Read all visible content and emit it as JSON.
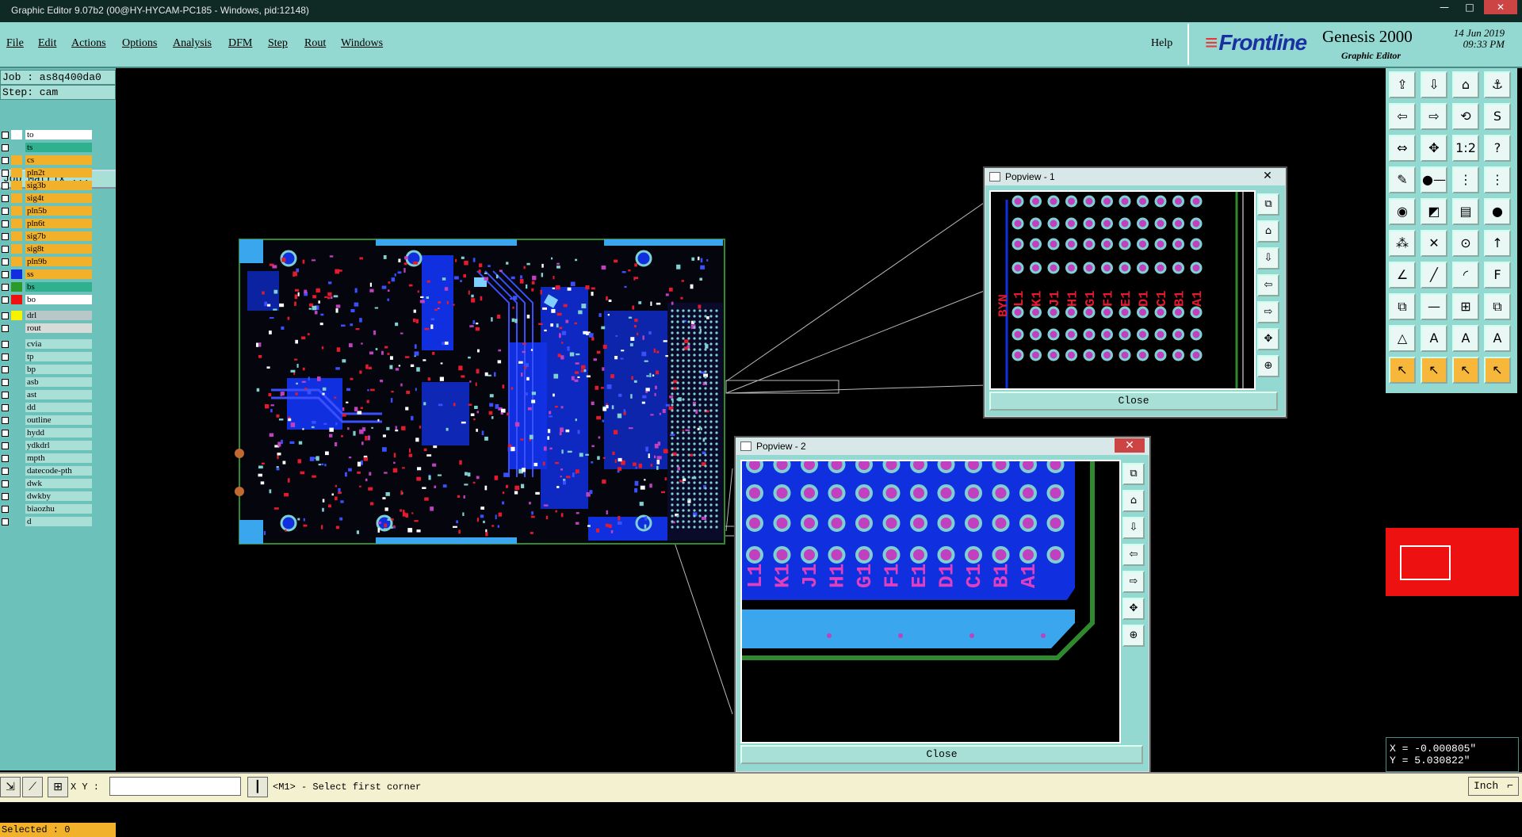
{
  "window": {
    "title": "Graphic Editor 9.07b2 (00@HY-HYCAM-PC185 - Windows, pid:12148)",
    "minimize": "—",
    "maximize": "□",
    "close": "✕"
  },
  "menu": {
    "items": [
      "File",
      "Edit",
      "Actions",
      "Options",
      "Analysis",
      "DFM",
      "Step",
      "Rout",
      "Windows"
    ],
    "help": "Help"
  },
  "brand": {
    "logo": "Frontline",
    "product": "Genesis 2000",
    "subtitle": "Graphic Editor",
    "date": "14 Jun 2019",
    "time": "09:33 PM"
  },
  "job": {
    "job_line": "Job : as8q400da0",
    "step_line": "Step: cam",
    "job_matrix": "Job Matrix ..."
  },
  "layers": [
    {
      "name": "to",
      "swatch": "#ffffff",
      "bg": "#ffffff",
      "arrow": "↵"
    },
    {
      "name": "ts",
      "swatch": "#6cc2ba",
      "bg": "#2fb08e",
      "arrow": ""
    },
    {
      "name": "cs",
      "swatch": "#f2b12a",
      "bg": "#f2b12a",
      "arrow": "↵"
    },
    {
      "name": "pln2t",
      "swatch": "#f2b12a",
      "bg": "#f2b12a",
      "arrow": ""
    },
    {
      "name": "sig3b",
      "swatch": "#f2b12a",
      "bg": "#f2b12a",
      "arrow": "↵"
    },
    {
      "name": "sig4t",
      "swatch": "#f2b12a",
      "bg": "#f2b12a",
      "arrow": "↵"
    },
    {
      "name": "pln5b",
      "swatch": "#f2b12a",
      "bg": "#f2b12a",
      "arrow": ""
    },
    {
      "name": "pln6t",
      "swatch": "#f2b12a",
      "bg": "#f2b12a",
      "arrow": ""
    },
    {
      "name": "sig7b",
      "swatch": "#f2b12a",
      "bg": "#f2b12a",
      "arrow": "↵"
    },
    {
      "name": "sig8t",
      "swatch": "#f2b12a",
      "bg": "#f2b12a",
      "arrow": "↵"
    },
    {
      "name": "pln9b",
      "swatch": "#f2b12a",
      "bg": "#f2b12a",
      "arrow": ""
    },
    {
      "name": "ss",
      "swatch": "#1030e0",
      "bg": "#f2b12a",
      "arrow": "↵"
    },
    {
      "name": "bs",
      "swatch": "#2b9a2b",
      "bg": "#2fb08e",
      "arrow": ""
    },
    {
      "name": "bo",
      "swatch": "#ee1111",
      "bg": "#ffffff",
      "arrow": "↵"
    }
  ],
  "drill_layers": [
    {
      "name": "drl",
      "swatch": "#f7f200",
      "bg": "#b8c8c8",
      "arrow": "≡"
    },
    {
      "name": "rout",
      "swatch": "#6cc2ba",
      "bg": "#d8dcd8",
      "arrow": ""
    }
  ],
  "misc_layers": [
    {
      "name": "cvia",
      "arrow": ""
    },
    {
      "name": "tp",
      "arrow": ""
    },
    {
      "name": "bp",
      "arrow": ""
    },
    {
      "name": "asb",
      "arrow": "↵"
    },
    {
      "name": "ast",
      "arrow": "↵"
    },
    {
      "name": "dd",
      "arrow": ""
    },
    {
      "name": "outline",
      "arrow": ""
    },
    {
      "name": "hydd",
      "arrow": ""
    },
    {
      "name": "ydkdrl",
      "arrow": ""
    },
    {
      "name": "mpth",
      "arrow": ""
    },
    {
      "name": "datecode-pth",
      "arrow": ""
    },
    {
      "name": "dwk",
      "arrow": ""
    },
    {
      "name": "dwkby",
      "arrow": ""
    },
    {
      "name": "biaozhu",
      "arrow": ""
    },
    {
      "name": "d",
      "arrow": ""
    }
  ],
  "selected": "Selected : 0",
  "status": {
    "xy_label": "X Y :",
    "xy_value": "",
    "prompt": "<M1> - Select first corner",
    "units": "Inch",
    "units_arrow": "⌐"
  },
  "coords": {
    "x": "X = -0.000805\"",
    "y": "Y = 5.030822\""
  },
  "popview1": {
    "title": "Popview - 1",
    "close_label": "Close",
    "labels": [
      "L1",
      "K1",
      "J1",
      "H1",
      "G1",
      "F1",
      "E1",
      "D1",
      "C1",
      "B1",
      "A1"
    ],
    "side_label": "BYN"
  },
  "popview2": {
    "title": "Popview - 2",
    "close_label": "Close",
    "labels": [
      "L1",
      "K1",
      "J1",
      "H1",
      "G1",
      "F1",
      "E1",
      "D1",
      "C1",
      "B1",
      "A1"
    ]
  },
  "colors": {
    "teal_panel": "#93d8d1",
    "board_blue": "#1030e0",
    "pad_magenta": "#c040c0",
    "pad_ring": "#7fd0d0",
    "label_red": "#e51a2e",
    "outline_green": "#2f8a2f"
  },
  "toolbar_icons": [
    "zoom-home-icon",
    "zoom-fit-icon",
    "home-icon",
    "snap-icon",
    "pan-left-icon",
    "pan-right-icon",
    "rotate-icon",
    "s-curve-icon",
    "fit-width-icon",
    "fit-all-icon",
    "scale-1to2-icon",
    "help-icon",
    "script-icon",
    "line-measure-icon",
    "layer-compare-icon",
    "layer-diff-icon",
    "circle-pad-icon",
    "rect-pad-icon",
    "grid-pad-icon",
    "dot-pad-icon",
    "net-icon",
    "cross-icon",
    "node-icon",
    "arrow-up-icon",
    "angle-icon",
    "slope-icon",
    "arc-icon",
    "flip-icon",
    "pad-move-icon",
    "line-icon",
    "measure-icon",
    "copy-icon",
    "triangle-icon",
    "triangle-a-icon",
    "triangle-b-icon",
    "triangle-c-icon",
    "select-icon",
    "select-box-icon",
    "select-net-icon",
    "select-multi-icon"
  ]
}
